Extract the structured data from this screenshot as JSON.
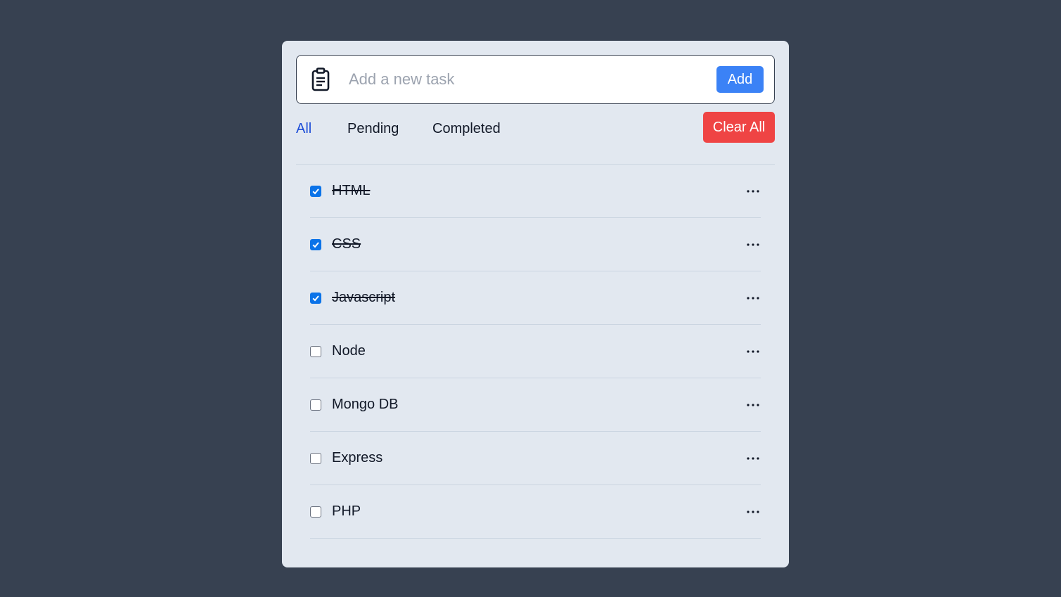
{
  "input": {
    "placeholder": "Add a new task",
    "value": ""
  },
  "add_button": {
    "label": "Add"
  },
  "filters": [
    {
      "label": "All",
      "active": true
    },
    {
      "label": "Pending",
      "active": false
    },
    {
      "label": "Completed",
      "active": false
    }
  ],
  "clear_button": {
    "label": "Clear All"
  },
  "tasks": [
    {
      "label": "HTML",
      "done": true
    },
    {
      "label": "CSS",
      "done": true
    },
    {
      "label": "Javascript",
      "done": true
    },
    {
      "label": "Node",
      "done": false
    },
    {
      "label": "Mongo DB",
      "done": false
    },
    {
      "label": "Express",
      "done": false
    },
    {
      "label": "PHP",
      "done": false
    }
  ],
  "colors": {
    "background": "#374151",
    "card": "#e2e8f0",
    "accent": "#3b82f6",
    "danger": "#ef4444",
    "active_filter": "#1d4ed8",
    "checkbox": "#0b73e8"
  },
  "icons": {
    "input": "clipboard-icon",
    "task_menu": "ellipsis-icon",
    "checked": "checkmark-icon"
  }
}
